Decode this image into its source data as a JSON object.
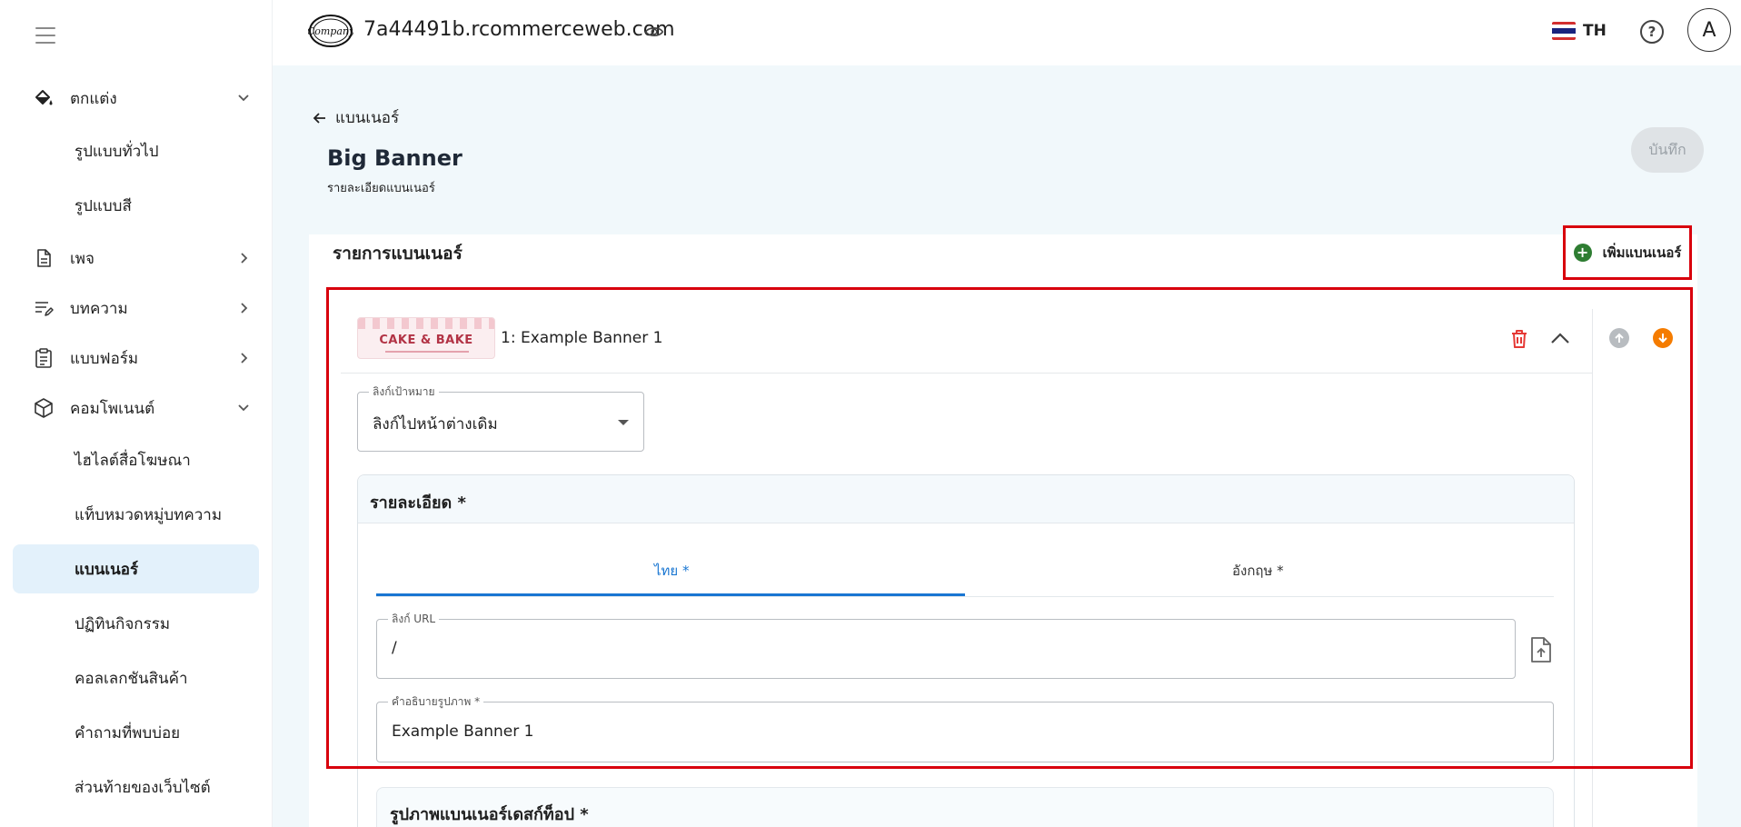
{
  "sidebar": {
    "items": [
      {
        "label": "ตกแต่ง",
        "icon": "paint-bucket-icon",
        "expanded": true
      },
      {
        "label": "รูปแบบทั่วไป"
      },
      {
        "label": "รูปแบบสี"
      },
      {
        "label": "เพจ",
        "icon": "document-icon"
      },
      {
        "label": "บทความ",
        "icon": "article-edit-icon"
      },
      {
        "label": "แบบฟอร์ม",
        "icon": "clipboard-icon"
      },
      {
        "label": "คอมโพเนนต์",
        "icon": "cube-icon",
        "expanded": true
      },
      {
        "label": "ไฮไลต์สื่อโฆษณา"
      },
      {
        "label": "แท็บหมวดหมู่บทความ"
      },
      {
        "label": "แบนเนอร์",
        "active": true
      },
      {
        "label": "ปฏิทินกิจกรรม"
      },
      {
        "label": "คอลเลกชันสินค้า"
      },
      {
        "label": "คำถามที่พบบ่อย"
      },
      {
        "label": "ส่วนท้ายของเว็บไซต์"
      }
    ]
  },
  "topbar": {
    "domain": "7a44491b.rcommerceweb.com",
    "logo_text": "Company",
    "language": "TH",
    "avatar_letter": "A"
  },
  "header": {
    "back_label": "แบนเนอร์",
    "title": "Big Banner",
    "subtitle": "รายละเอียดแบนเนอร์",
    "save_label": "บันทึก"
  },
  "card": {
    "title": "รายการแบนเนอร์",
    "add_label": "เพิ่มแบนเนอร์",
    "item": {
      "title": "1: Example Banner 1",
      "thumbnail_text": "CAKE & BAKE",
      "link_target": {
        "label": "ลิงก์เป้าหมาย",
        "value": "ลิงก์ไปหน้าต่างเดิม"
      },
      "detail": {
        "title": "รายละเอียด *",
        "tabs": [
          {
            "label": "ไทย *",
            "active": true
          },
          {
            "label": "อังกฤษ *",
            "active": false
          }
        ],
        "url_field": {
          "label": "ลิงก์ URL",
          "value": "/"
        },
        "alt_field": {
          "label": "คำอธิบายรูปภาพ *",
          "value": "Example Banner 1"
        }
      },
      "next_section_title": "รูปภาพแบนเนอร์เดสก์ท็อป *"
    }
  },
  "colors": {
    "accent": "#1976d2",
    "highlight": "#d8000c",
    "add_icon": "#2e7d32",
    "delete_icon": "#e53935",
    "move_down": "#f57c00"
  }
}
